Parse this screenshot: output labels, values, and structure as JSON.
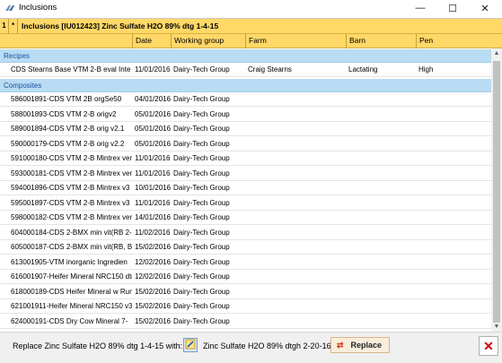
{
  "window": {
    "title": "Inclusions",
    "icon": "flask-icon",
    "buttons": {
      "minimize": "—",
      "maximize": "☐",
      "close": "✕"
    }
  },
  "grid": {
    "row_number": "1",
    "star": "*",
    "caption": "Inclusions [IU012423]  Zinc Sulfate H2O 89% dtg 1-4-15",
    "columns": [
      "",
      "Date",
      "Working group",
      "Farm",
      "Barn",
      "Pen"
    ],
    "groups": {
      "recipes": {
        "label": "Recipes",
        "rows": [
          [
            "CDS  Stearns Base VTM 2-B eval Inte",
            "11/01/2016",
            "Dairy-Tech Group",
            "Craig Stearns",
            "Lactating",
            "High"
          ]
        ]
      },
      "composites": {
        "label": "Composites",
        "rows": [
          [
            "586001891-CDS VTM 2B orgSe50",
            "04/01/2016",
            "Dairy-Tech Group",
            "",
            "",
            ""
          ],
          [
            "588001893-CDS VTM 2-B origv2",
            "05/01/2016",
            "Dairy-Tech Group",
            "",
            "",
            ""
          ],
          [
            "589001894-CDS VTM 2-B orig v2.1",
            "05/01/2016",
            "Dairy-Tech Group",
            "",
            "",
            ""
          ],
          [
            "590000179-CDS VTM 2-B orig v2.2",
            "05/01/2016",
            "Dairy-Tech Group",
            "",
            "",
            ""
          ],
          [
            "591000180-CDS VTM 2-B Mintrex ver",
            "11/01/2016",
            "Dairy-Tech Group",
            "",
            "",
            ""
          ],
          [
            "593000181-CDS VTM 2-B Mintrex ver",
            "11/01/2016",
            "Dairy-Tech Group",
            "",
            "",
            ""
          ],
          [
            "594001896-CDS VTM 2-B Mintrex v3",
            "10/01/2016",
            "Dairy-Tech Group",
            "",
            "",
            ""
          ],
          [
            "595001897-CDS VTM 2-B Mintrex v3",
            "11/01/2016",
            "Dairy-Tech Group",
            "",
            "",
            ""
          ],
          [
            "598000182-CDS VTM 2-B Mintrex ver",
            "14/01/2016",
            "Dairy-Tech Group",
            "",
            "",
            ""
          ],
          [
            "604000184-CDS 2-BMX min vit(RB 2-",
            "11/02/2016",
            "Dairy-Tech Group",
            "",
            "",
            ""
          ],
          [
            "605000187-CDS 2-BMX min vit(RB, B",
            "15/02/2016",
            "Dairy-Tech Group",
            "",
            "",
            ""
          ],
          [
            "613001905-VTM  inorganic Ingredien",
            "12/02/2016",
            "Dairy-Tech Group",
            "",
            "",
            ""
          ],
          [
            "616001907-Heifer Mineral NRC150 dtg",
            "12/02/2016",
            "Dairy-Tech Group",
            "",
            "",
            ""
          ],
          [
            "618000189-CDS Heifer Mineral w Rum",
            "15/02/2016",
            "Dairy-Tech Group",
            "",
            "",
            ""
          ],
          [
            "621001911-Heifer Mineral NRC150 v3",
            "15/02/2016",
            "Dairy-Tech Group",
            "",
            "",
            ""
          ],
          [
            "624000191-CDS Dry Cow Mineral  7-",
            "15/02/2016",
            "Dairy-Tech Group",
            "",
            "",
            ""
          ],
          [
            "628001917-Heifer Mineral NRC150 v4",
            "17/02/2016",
            "Dairy-Tech Group",
            "",
            "",
            ""
          ]
        ]
      }
    }
  },
  "footer": {
    "replace_label": "Replace Zinc Sulfate H2O 89% dtg 1-4-15 with:",
    "selected_ingredient": "Zinc Sulfate H2O 89% dtgh 2-20-16",
    "replace_button": "Replace",
    "replace_icon": "swap-arrows-icon",
    "close_icon": "close-icon"
  },
  "colors": {
    "header_bg": "#ffd868",
    "group_bg": "#b9dcf4",
    "group_text": "#1a4fa0",
    "close_red": "#d8000c"
  }
}
